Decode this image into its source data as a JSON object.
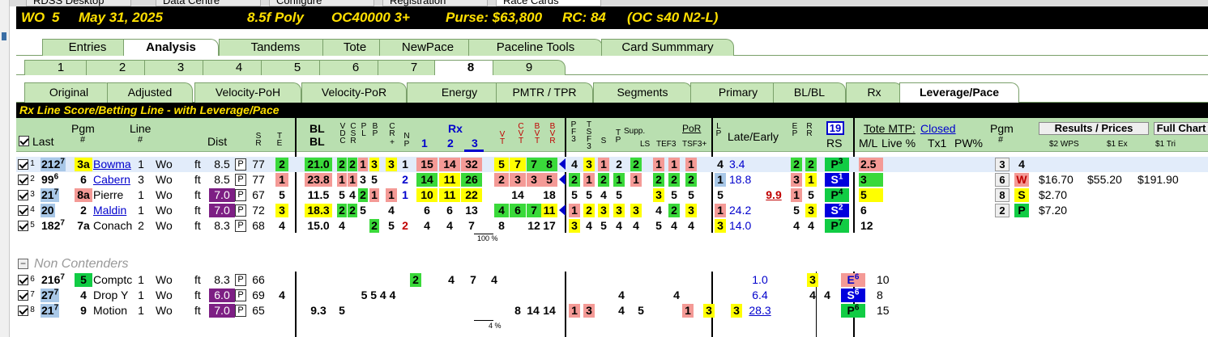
{
  "window_tabs": [
    "RDSS Desktop",
    "Data Centre",
    "Configure",
    "Registration",
    "Race Cards"
  ],
  "race": {
    "track": "WO",
    "race_no": "5",
    "date": "May 31, 2025",
    "distance_surface": "8.5f Poly",
    "class": "OC40000 3+",
    "purse": "Purse: $63,800",
    "rc": "RC: 84",
    "rc_detail": "(OC s40 N2-L)"
  },
  "main_tabs": [
    "Entries",
    "Analysis",
    "Tandems",
    "Tote",
    "NewPace",
    "Paceline Tools",
    "Card Summmary"
  ],
  "main_tab_selected": "Analysis",
  "race_tabs": [
    "1",
    "2",
    "3",
    "4",
    "5",
    "6",
    "7",
    "8",
    "9"
  ],
  "race_tab_selected": "8",
  "sub_tabs": [
    "Original",
    "Adjusted",
    "Velocity-PoH",
    "Velocity-PoR",
    "Energy",
    "PMTR / TPR",
    "Segments",
    "Primary",
    "BL/BL",
    "Rx",
    "Leverage/Pace"
  ],
  "sub_tab_selected": "Leverage/Pace",
  "section_title": "Rx Line Score/Betting Line - with Leverage/Pace",
  "headers": {
    "last": "Last",
    "pgm": "Pgm",
    "pgm_hash": "#",
    "line": "Line",
    "line_hash": "#",
    "dist": "Dist",
    "sr": "SR",
    "te": "TE",
    "bl": "BL",
    "bl2": "BL",
    "vdc": "VDC",
    "csr": "CSR",
    "pl": "PL",
    "bp": "BP",
    "cr": "CR",
    "crp": "+",
    "n": "N",
    "np": "P",
    "rx": "Rx",
    "rx1": "1",
    "rx2": "2",
    "rx3": "3",
    "vt": "VT",
    "cvt": "CVT",
    "bvt": "BVT",
    "bvr": "BVR",
    "pf3": "PF3",
    "tsf3": "TSF3",
    "s": "S",
    "tp": "TP",
    "supp": "Supp.",
    "ls": "LS",
    "por": "PoR",
    "tef3": "TEF3",
    "tsf3p": "TSF3+",
    "lp": "LP",
    "late_early": "Late/Early",
    "ep": "EP",
    "rr": "RR",
    "rs_box": "19",
    "rs": "RS",
    "tote_mtp": "Tote MTP:",
    "mtp_status": "Closed",
    "ml": "M/L",
    "live": "Live %",
    "tx1": "Tx1",
    "pw": "PW%",
    "pgm2": "Pgm",
    "pgm2_hash": "#",
    "results_btn": "Results / Prices",
    "full_chart_btn": "Full Chart",
    "wps": "$2 WPS",
    "ex": "$1 Ex",
    "tri": "$1 Tri"
  },
  "rows": [
    {
      "n": "1",
      "last": "212",
      "last_sup": "7",
      "pgm": "3a",
      "name": "Bowma",
      "line": "1",
      "track": "Wo",
      "surf": "ft",
      "dist": "8.5",
      "sr": "77",
      "te": "2",
      "bl": "21.0",
      "v": "2",
      "c": "2",
      "p": "1",
      "l": "3",
      "cr": "3",
      "np": "1",
      "rx1": "15",
      "rx2": "14",
      "rx3": "32",
      "vt": "5",
      "cvt": "7",
      "bvt": "7",
      "bvr": "8",
      "pf": "4",
      "f3": "3",
      "s": "1",
      "tp": "2",
      "supp": "2",
      "ls": "",
      "por1": "1",
      "por2": "1",
      "por3": "1",
      "lp": "4",
      "late": "3.4",
      "early": "",
      "e": "2",
      "r": "2",
      "rs": "P",
      "rs_sup": "3",
      "ml": "2.5"
    },
    {
      "n": "2",
      "last": "99",
      "last_sup": "6",
      "pgm": "6",
      "name": "Cabern",
      "line": "3",
      "track": "Wo",
      "surf": "ft",
      "dist": "8.5",
      "sr": "77",
      "te": "1",
      "bl": "23.8",
      "v": "1",
      "c": "1",
      "p": "3",
      "l": "5",
      "cr": "",
      "np": "2",
      "rx1": "14",
      "rx2": "11",
      "rx3": "26",
      "vt": "2",
      "cvt": "3",
      "bvt": "3",
      "bvr": "5",
      "pf": "2",
      "f3": "1",
      "s": "2",
      "tp": "1",
      "supp": "1",
      "ls": "",
      "por1": "2",
      "por2": "2",
      "por3": "2",
      "lp": "1",
      "late": "18.8",
      "early": "",
      "e": "3",
      "r": "1",
      "rs": "S",
      "rs_sup": "1",
      "ml": "3"
    },
    {
      "n": "3",
      "last": "21",
      "last_sup": "7",
      "pgm": "8a",
      "name": "Pierre",
      "line": "1",
      "track": "Wo",
      "surf": "ft",
      "dist": "7.0",
      "sr": "67",
      "te": "5",
      "bl": "11.5",
      "v": "5",
      "c": "4",
      "p": "2",
      "l": "1",
      "cr": "1",
      "np": "1",
      "rx1": "10",
      "rx2": "11",
      "rx3": "22",
      "vt": "",
      "cvt": "14",
      "bvt": "",
      "bvr": "18",
      "pf": "5",
      "f3": "5",
      "s": "4",
      "tp": "5",
      "supp": "",
      "ls": "",
      "por1": "3",
      "por2": "5",
      "por3": "5",
      "lp": "5",
      "late": "",
      "early": "9.9",
      "e": "1",
      "r": "5",
      "rs": "P",
      "rs_sup": "4",
      "ml": "5"
    },
    {
      "n": "4",
      "last": "20",
      "last_sup": "",
      "pgm": "2",
      "name": "Maldin",
      "line": "1",
      "track": "Wo",
      "surf": "ft",
      "dist": "7.0",
      "sr": "72",
      "te": "3",
      "bl": "18.3",
      "v": "2",
      "c": "2",
      "p": "5",
      "l": "",
      "cr": "4",
      "np": "",
      "rx1": "6",
      "rx2": "6",
      "rx3": "13",
      "vt": "4",
      "cvt": "6",
      "bvt": "7",
      "bvr": "11",
      "pf": "1",
      "f3": "2",
      "s": "3",
      "tp": "3",
      "supp": "3",
      "ls": "",
      "por1": "4",
      "por2": "2",
      "por3": "3",
      "lp": "1",
      "late": "24.2",
      "early": "",
      "e": "5",
      "r": "3",
      "rs": "S",
      "rs_sup": "2",
      "ml": "6"
    },
    {
      "n": "5",
      "last": "182",
      "last_sup": "7",
      "pgm": "7a",
      "name": "Conach",
      "line": "2",
      "track": "Wo",
      "surf": "ft",
      "dist": "8.3",
      "sr": "68",
      "te": "4",
      "bl": "15.0",
      "v": "4",
      "c": "",
      "p": "",
      "l": "2",
      "cr": "5",
      "np": "2",
      "rx1": "4",
      "rx2": "4",
      "rx3": "7",
      "vt": "8",
      "cvt": "",
      "bvt": "12",
      "bvr": "17",
      "pf": "3",
      "f3": "4",
      "s": "5",
      "tp": "4",
      "supp": "4",
      "ls": "",
      "por1": "5",
      "por2": "4",
      "por3": "4",
      "lp": "3",
      "late": "14.0",
      "early": "",
      "e": "4",
      "r": "4",
      "rs": "P",
      "rs_sup": "7",
      "ml": "12"
    }
  ],
  "pct_top": "100 %",
  "non_contenders_label": "Non Contenders",
  "nc_rows": [
    {
      "n": "6",
      "last": "216",
      "last_sup": "7",
      "pgm": "5",
      "name": "Comptc",
      "line": "1",
      "track": "Wo",
      "surf": "ft",
      "dist": "8.3",
      "sr": "66",
      "te": "",
      "bl": "",
      "cr": "2",
      "rx1": "4",
      "rx2": "7",
      "rx3": "4",
      "late": "1.0",
      "e": "3",
      "r": "",
      "rs": "E",
      "rs_sup": "6",
      "ml": "10"
    },
    {
      "n": "7",
      "last": "27",
      "last_sup": "7",
      "pgm": "4",
      "name": "Drop Y",
      "line": "1",
      "track": "Wo",
      "surf": "ft",
      "dist": "6.0",
      "sr": "69",
      "te": "4",
      "vdc": "5 5 4 4",
      "s": "4",
      "por_lbl": "4",
      "late": "6.4",
      "e": "4",
      "r": "4",
      "rs": "S",
      "rs_sup": "6",
      "ml": "8"
    },
    {
      "n": "8",
      "last": "21",
      "last_sup": "7",
      "pgm": "9",
      "name": "Motion",
      "line": "1",
      "track": "Wo",
      "surf": "ft",
      "dist": "7.0",
      "sr": "65",
      "bl": "9.3",
      "v": "5",
      "bv": "8",
      "bvt": "14",
      "bvr": "14",
      "pf": "1",
      "f3": "3",
      "s": "4",
      "tp": "5",
      "por1": "1",
      "por3": "3",
      "lp": "3",
      "late": "28.3",
      "rs": "P",
      "rs_sup": "6",
      "ml": "15"
    }
  ],
  "pct_bottom": "4 %",
  "results": [
    {
      "pgm": "3",
      "pos": "4",
      "price": "",
      "ex": "",
      "tri": ""
    },
    {
      "pgm": "6",
      "pos": "W",
      "price": "$16.70",
      "ex": "$55.20",
      "tri": "$191.90"
    },
    {
      "pgm": "8",
      "pos": "S",
      "price": "$2.70",
      "ex": "",
      "tri": ""
    },
    {
      "pgm": "2",
      "pos": "P",
      "price": "$7.20",
      "ex": "",
      "tri": ""
    }
  ],
  "colors": {
    "green": "#3ad93a",
    "red": "#f49a96",
    "yellow": "#ffff00",
    "purple": "#7d1f84",
    "blue": "#0000dd",
    "header": "#b9dfb0",
    "tab": "#c8e6b9"
  }
}
